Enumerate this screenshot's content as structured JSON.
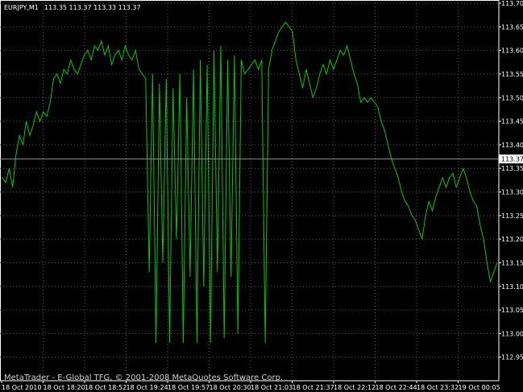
{
  "header": {
    "symbol": "EURJPY,M1",
    "ohlc": "113.35 113.37 113.33 113.37"
  },
  "watermark": "MetaTrader - E-Global TFG, © 2001-2008 MetaQuotes Software Corp.",
  "price_marker": "113.37",
  "colors": {
    "background": "#000000",
    "line": "#00c800",
    "grid": "#5a5a5a",
    "axis": "#ffffff",
    "marker_bg": "#ffffff",
    "marker_text": "#000000"
  },
  "chart_data": {
    "type": "line",
    "title": "",
    "ylim": [
      112.9,
      113.7
    ],
    "grid": true,
    "y_ticks": [
      "113.70",
      "113.65",
      "113.60",
      "113.55",
      "113.50",
      "113.45",
      "113.40",
      "113.35",
      "113.30",
      "113.25",
      "113.20",
      "113.15",
      "113.10",
      "113.05",
      "113.00",
      "112.95"
    ],
    "x_ticks": [
      "18 Oct 2010",
      "18 Oct 18:20",
      "18 Oct 18:52",
      "18 Oct 19:24",
      "18 Oct 19:57",
      "18 Oct 20:30",
      "18 Oct 21:03",
      "18 Oct 21:37",
      "18 Oct 22:12",
      "18 Oct 22:44",
      "18 Oct 23:32",
      "19 Oct 00:05"
    ],
    "last_price": 113.37,
    "series": [
      {
        "values": [
          113.33,
          113.32,
          113.35,
          113.31,
          113.38,
          113.42,
          113.4,
          113.45,
          113.42,
          113.44,
          113.47,
          113.45,
          113.47,
          113.46,
          113.49,
          113.54,
          113.55,
          113.53,
          113.56,
          113.55,
          113.58,
          113.56,
          113.55,
          113.57,
          113.59,
          113.6,
          113.58,
          113.61,
          113.6,
          113.62,
          113.59,
          113.61,
          113.57,
          113.59,
          113.6,
          113.58,
          113.61,
          113.59,
          113.58,
          113.6,
          113.56,
          113.55,
          113.54,
          113.13,
          113.55,
          112.98,
          113.53,
          113.15,
          113.54,
          112.98,
          113.52,
          113.2,
          113.55,
          112.98,
          113.5,
          113.12,
          113.56,
          112.98,
          113.58,
          113.1,
          113.57,
          112.98,
          113.6,
          113.13,
          113.61,
          112.99,
          113.58,
          113.12,
          113.59,
          113.0,
          113.58,
          113.55,
          113.56,
          113.57,
          113.58,
          113.56,
          113.58,
          112.98,
          113.56,
          113.6,
          113.62,
          113.64,
          113.65,
          113.66,
          113.65,
          113.64,
          113.58,
          113.55,
          113.52,
          113.56,
          113.53,
          113.5,
          113.52,
          113.55,
          113.57,
          113.55,
          113.58,
          113.56,
          113.58,
          113.6,
          113.59,
          113.61,
          113.58,
          113.55,
          113.53,
          113.49,
          113.5,
          113.49,
          113.5,
          113.49,
          113.48,
          113.45,
          113.43,
          113.4,
          113.37,
          113.35,
          113.33,
          113.3,
          113.28,
          113.27,
          113.25,
          113.24,
          113.22,
          113.2,
          113.25,
          113.28,
          113.26,
          113.29,
          113.31,
          113.33,
          113.31,
          113.33,
          113.34,
          113.31,
          113.33,
          113.35,
          113.33,
          113.3,
          113.28,
          113.27,
          113.23,
          113.2,
          113.15,
          113.11,
          113.13,
          113.15
        ]
      }
    ]
  }
}
